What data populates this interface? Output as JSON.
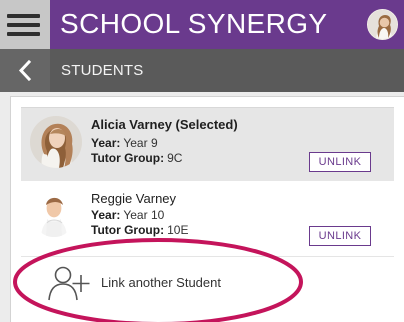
{
  "app": {
    "title": "SCHOOL SYNERGY"
  },
  "header": {
    "menu_icon": "hamburger-icon",
    "avatar_icon": "user-avatar"
  },
  "subheader": {
    "back_icon": "chevron-left-icon",
    "title": "STUDENTS"
  },
  "students": [
    {
      "name": "Alicia Varney (Selected)",
      "year_label": "Year:",
      "year_value": "Year 9",
      "tutor_label": "Tutor Group:",
      "tutor_value": "9C",
      "action": "UNLINK",
      "selected": true
    },
    {
      "name": "Reggie Varney",
      "year_label": "Year:",
      "year_value": "Year 10",
      "tutor_label": "Tutor Group:",
      "tutor_value": "10E",
      "action": "UNLINK",
      "selected": false
    }
  ],
  "link_action": {
    "icon": "add-user-icon",
    "label": "Link another Student"
  },
  "colors": {
    "brand": "#6a3a8d",
    "subheader": "#5a5a5a",
    "annotation": "#c4145b"
  }
}
